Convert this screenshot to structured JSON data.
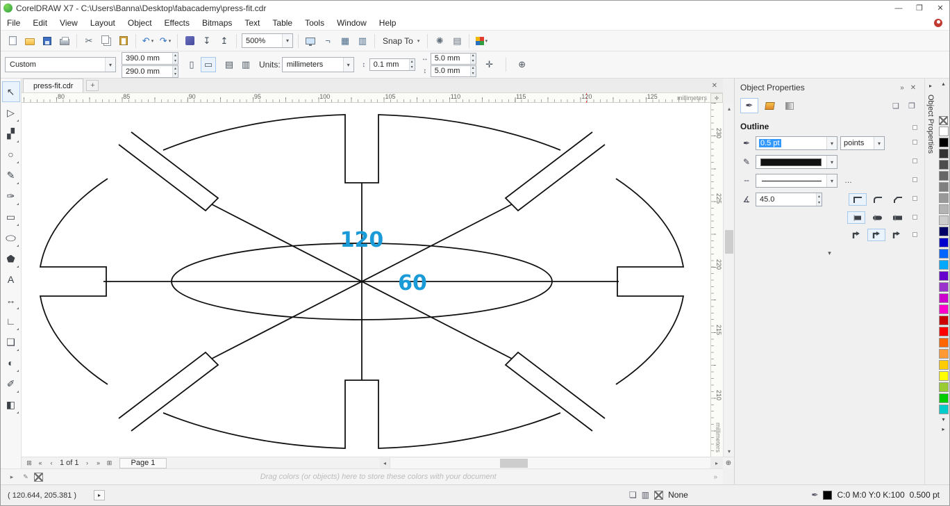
{
  "window": {
    "title": "CorelDRAW X7 - C:\\Users\\Banna\\Desktop\\fabacademy\\press-fit.cdr"
  },
  "icons": {
    "minimize": "—",
    "maximize": "❐",
    "close": "✕",
    "down": "▾",
    "up": "▴",
    "left": "◂",
    "right": "▸",
    "first": "«",
    "prev": "‹",
    "next": "›",
    "last": "»",
    "plus": "+",
    "insert_page": "⊞",
    "flyout": "»",
    "crosshair": "✛",
    "zoom_corner": "⊕",
    "ellipsis": "…",
    "portrait": "▯",
    "landscape": "▭",
    "nudge": "↕",
    "dup_x": "↔",
    "dup_y": "↕",
    "treat_filled": "⊕",
    "select_options": "✛",
    "pen": "✒",
    "pencil": "✎",
    "line_style": "╌",
    "angle": "∡",
    "page_a": "▤",
    "page_b": "▥",
    "frame_a": "❏",
    "frame_b": "❐"
  },
  "menu": {
    "items": [
      "File",
      "Edit",
      "View",
      "Layout",
      "Object",
      "Effects",
      "Bitmaps",
      "Text",
      "Table",
      "Tools",
      "Window",
      "Help"
    ]
  },
  "toolbar": {
    "zoom_value": "500%",
    "snap_to_label": "Snap To",
    "buttons": [
      {
        "name": "new-document",
        "cls": "ic-page"
      },
      {
        "name": "open-document",
        "cls": "ic-folder"
      },
      {
        "name": "save-document",
        "cls": "ic-save"
      },
      {
        "name": "print-document",
        "cls": "ic-print"
      },
      {
        "sep": true
      },
      {
        "name": "cut",
        "g": "✂",
        "color": "#5a6570"
      },
      {
        "name": "copy",
        "cls": "ic-copy"
      },
      {
        "name": "paste",
        "cls": "ic-paste"
      },
      {
        "sep": true
      },
      {
        "name": "undo",
        "g": "↶",
        "color": "#2f72c4",
        "dd": true
      },
      {
        "name": "redo",
        "g": "↷",
        "color": "#2f72c4",
        "dd": true
      },
      {
        "sep": true
      },
      {
        "name": "search-content",
        "cls": "ic-connect"
      },
      {
        "name": "import",
        "g": "↧",
        "color": "#3f4c58"
      },
      {
        "name": "export",
        "g": "↥",
        "color": "#3f4c58"
      },
      {
        "sep": true
      },
      {
        "zoom": true
      },
      {
        "sep": true
      },
      {
        "name": "full-screen-preview",
        "cls": "ic-monitor"
      },
      {
        "name": "show-rulers",
        "g": "¬",
        "color": "#4a6b8a"
      },
      {
        "name": "show-grid",
        "g": "▦",
        "color": "#4a6b8a"
      },
      {
        "name": "show-guidelines",
        "g": "▥",
        "color": "#4a6b8a"
      },
      {
        "sep": true
      },
      {
        "snap": true
      },
      {
        "sep": true
      },
      {
        "name": "options",
        "g": "✺",
        "color": "#64707c"
      },
      {
        "name": "welcome-screen",
        "g": "▤",
        "color": "#64707c"
      },
      {
        "sep": true
      },
      {
        "name": "application-launcher",
        "cls": "ic-corelapps",
        "dd": true
      }
    ]
  },
  "propbar": {
    "preset": "Custom",
    "page_width": "390.0 mm",
    "page_height": "290.0 mm",
    "units_label": "Units:",
    "units_value": "millimeters",
    "nudge_value": "0.1 mm",
    "dup_x": "5.0 mm",
    "dup_y": "5.0 mm"
  },
  "document": {
    "name": "press-fit.cdr"
  },
  "toolbox": {
    "tools": [
      {
        "name": "pick-tool",
        "icon": "pick-arrow-icon",
        "g": "↖",
        "active": true
      },
      {
        "name": "shape-tool",
        "icon": "shape-node-icon",
        "g": "▷",
        "fly": true
      },
      {
        "name": "crop-tool",
        "icon": "crop-icon",
        "g": "▞",
        "fly": true
      },
      {
        "name": "zoom-tool",
        "icon": "magnifier-icon",
        "g": "○",
        "fly": true
      },
      {
        "name": "freehand-tool",
        "icon": "freehand-curve-icon",
        "g": "✎",
        "fly": true
      },
      {
        "name": "artistic-media-tool",
        "icon": "artistic-media-icon",
        "g": "✑",
        "fly": true
      },
      {
        "name": "rectangle-tool",
        "icon": "rectangle-icon",
        "g": "▭",
        "fly": true
      },
      {
        "name": "ellipse-tool",
        "icon": "ellipse-icon",
        "g": "◯",
        "cls": "flat",
        "fly": true
      },
      {
        "name": "polygon-tool",
        "icon": "polygon-icon",
        "cls": "pent",
        "fly": true
      },
      {
        "name": "text-tool",
        "icon": "text-icon",
        "g": "A"
      },
      {
        "name": "parallel-dimension-tool",
        "icon": "dimension-icon",
        "g": "↔",
        "fly": true
      },
      {
        "name": "connector-tool",
        "icon": "connector-icon",
        "g": "∟",
        "fly": true
      },
      {
        "name": "drop-shadow-tool",
        "icon": "drop-shadow-icon",
        "g": "❑",
        "fly": true
      },
      {
        "name": "transparency-tool",
        "icon": "transparency-icon",
        "g": "◐",
        "fly": true
      },
      {
        "name": "color-eyedropper-tool",
        "icon": "eyedropper-icon",
        "g": "✐",
        "fly": true
      },
      {
        "name": "interactive-fill-tool",
        "icon": "fill-icon",
        "g": "◧",
        "fly": true
      }
    ]
  },
  "rulers": {
    "h_labels": [
      "80",
      "85",
      "90",
      "95",
      "100",
      "105",
      "110",
      "115",
      "120",
      "125"
    ],
    "v_labels": [
      "230",
      "225",
      "220",
      "215",
      "210"
    ],
    "unit": "millimeters"
  },
  "canvas": {
    "dim_width": "120",
    "dim_height": "60",
    "dim_color": "#1a9bd8"
  },
  "docker": {
    "title": "Object Properties",
    "tab_strip": "Object Properties",
    "section": "Outline",
    "width_value": "0.5 pt",
    "width_units": "points",
    "miter_value": "45.0"
  },
  "palette": {
    "colors": [
      "#FFFFFF",
      "#000000",
      "#333333",
      "#4D4D4D",
      "#666666",
      "#808080",
      "#999999",
      "#B3B3B3",
      "#CCCCCC",
      "#000066",
      "#0000CC",
      "#0066FF",
      "#00A8FF",
      "#6600CC",
      "#9933CC",
      "#CC00CC",
      "#FF00CC",
      "#CC0000",
      "#FF0000",
      "#FF6600",
      "#FF9933",
      "#FFCC00",
      "#FFFF00",
      "#99CC33",
      "#00CC00",
      "#00CCCC"
    ]
  },
  "nav": {
    "page_indicator": "1 of 1",
    "page_tab": "Page 1"
  },
  "status": {
    "drag_hint": "Drag colors (or objects) here to store these colors with your document",
    "coords": "( 120.644, 205.381 )",
    "fill_label": "None",
    "outline_cmyk": "C:0 M:0 Y:0 K:100",
    "outline_width": "0.500 pt"
  }
}
